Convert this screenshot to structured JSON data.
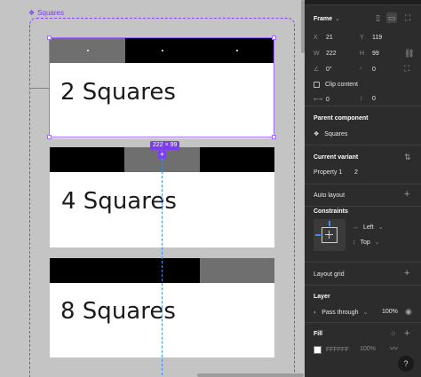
{
  "canvas": {
    "component_label": "Squares",
    "selection_size": "222 × 99",
    "cards": [
      {
        "title": "2 Squares",
        "segments": [
          {
            "color": "#6f6f6f",
            "dot": true
          },
          {
            "color": "#000000",
            "dot": true
          },
          {
            "color": "#000000",
            "dot": true
          }
        ]
      },
      {
        "title": "4 Squares",
        "segments": [
          {
            "color": "#000000",
            "dot": false
          },
          {
            "color": "#6f6f6f",
            "dot": false
          },
          {
            "color": "#000000",
            "dot": false
          }
        ]
      },
      {
        "title": "8 Squares",
        "segments": [
          {
            "color": "#000000",
            "dot": false
          },
          {
            "color": "#000000",
            "dot": false
          },
          {
            "color": "#6f6f6f",
            "dot": false
          }
        ]
      }
    ]
  },
  "panel": {
    "frame": {
      "title": "Frame",
      "x_label": "X",
      "x_value": "21",
      "y_label": "Y",
      "y_value": "119",
      "w_label": "W",
      "w_value": "222",
      "h_label": "H",
      "h_value": "99",
      "rotation_value": "0°",
      "radius_value": "0",
      "clip_content_label": "Clip content",
      "stroke_a_value": "0",
      "stroke_b_value": "0"
    },
    "parent_component": {
      "title": "Parent component",
      "name": "Squares"
    },
    "current_variant": {
      "title": "Current variant",
      "property_label": "Property 1",
      "property_value": "2"
    },
    "auto_layout": {
      "title": "Auto layout"
    },
    "constraints": {
      "title": "Constraints",
      "horizontal": "Left",
      "vertical": "Top"
    },
    "layout_grid": {
      "title": "Layout grid"
    },
    "layer": {
      "title": "Layer",
      "blend_mode": "Pass through",
      "opacity": "100%"
    },
    "fill": {
      "title": "Fill",
      "hex": "FFFFFF",
      "opacity": "100%"
    },
    "help": "?"
  }
}
